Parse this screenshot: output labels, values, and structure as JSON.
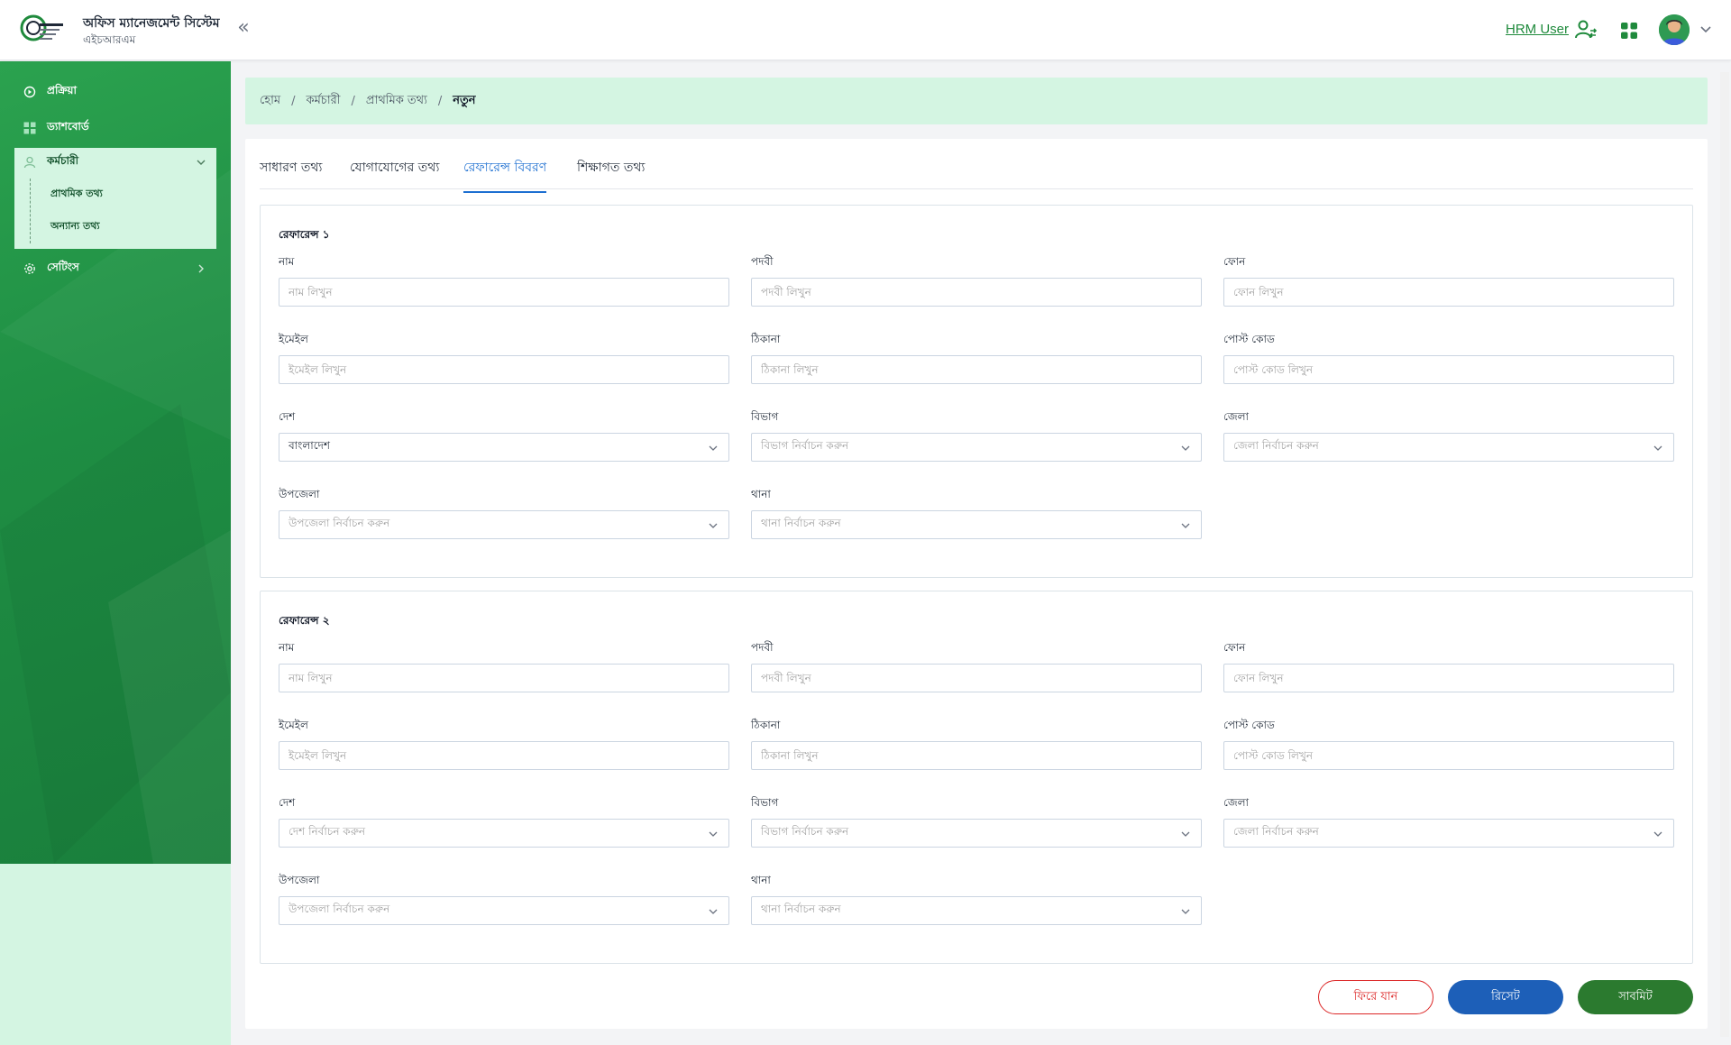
{
  "header": {
    "app_title": "অফিস ম্যানেজমেন্ট সিস্টেম",
    "app_subtitle": "এইচআরএম",
    "collapse_glyph": "«",
    "user_label": "HRM User"
  },
  "colors": {
    "brand_green": "#1f8a3c",
    "sidebar_active_bg": "#d4f5e2",
    "tab_active": "#1d6fd1",
    "reset_button": "#1d5fb8",
    "submit_button": "#2b7a2f",
    "back_button": "#dc2626"
  },
  "sidebar": {
    "items": [
      {
        "label": "প্রক্রিয়া",
        "icon": "process-icon"
      },
      {
        "label": "ড্যাশবোর্ড",
        "icon": "dashboard-icon"
      },
      {
        "label": "কর্মচারী",
        "icon": "employee-icon",
        "expanded": true
      },
      {
        "label": "সেটিংস",
        "icon": "settings-icon"
      }
    ],
    "sub_items": [
      "প্রাথমিক তথ্য",
      "অন্যান্য তথ্য"
    ]
  },
  "breadcrumb": [
    "হোম",
    "কর্মচারী",
    "প্রাথমিক তথ্য",
    "নতুন"
  ],
  "tabs": [
    {
      "label": "সাধারণ তথ্য",
      "active": false
    },
    {
      "label": "যোগাযোগের তথ্য",
      "active": false
    },
    {
      "label": "রেফারেন্স বিবরণ",
      "active": true
    },
    {
      "label": "শিক্ষাগত তথ্য",
      "active": false
    }
  ],
  "labels": {
    "name": "নাম",
    "designation": "পদবী",
    "phone": "ফোন",
    "email": "ইমেইল",
    "address": "ঠিকানা",
    "postcode": "পোস্ট কোড",
    "country": "দেশ",
    "division": "বিভাগ",
    "district": "জেলা",
    "upazila": "উপজেলা",
    "thana": "থানা"
  },
  "placeholders": {
    "name": "নাম লিখুন",
    "designation": "পদবী লিখুন",
    "phone": "ফোন লিখুন",
    "email": "ইমেইল লিখুন",
    "address": "ঠিকানা লিখুন",
    "postcode": "পোস্ট কোড লিখুন",
    "country": "দেশ নির্বাচন করুন",
    "division": "বিভাগ নির্বাচন করুন",
    "district": "জেলা নির্বাচন করুন",
    "upazila": "উপজেলা নির্বাচন করুন",
    "thana": "থানা নির্বাচন করুন"
  },
  "references": [
    {
      "title": "রেফারেন্স ১",
      "country_value": "বাংলাদেশ"
    },
    {
      "title": "রেফারেন্স ২",
      "country_value": ""
    }
  ],
  "buttons": {
    "back": "ফিরে যান",
    "reset": "রিসেট",
    "submit": "সাবমিট"
  }
}
